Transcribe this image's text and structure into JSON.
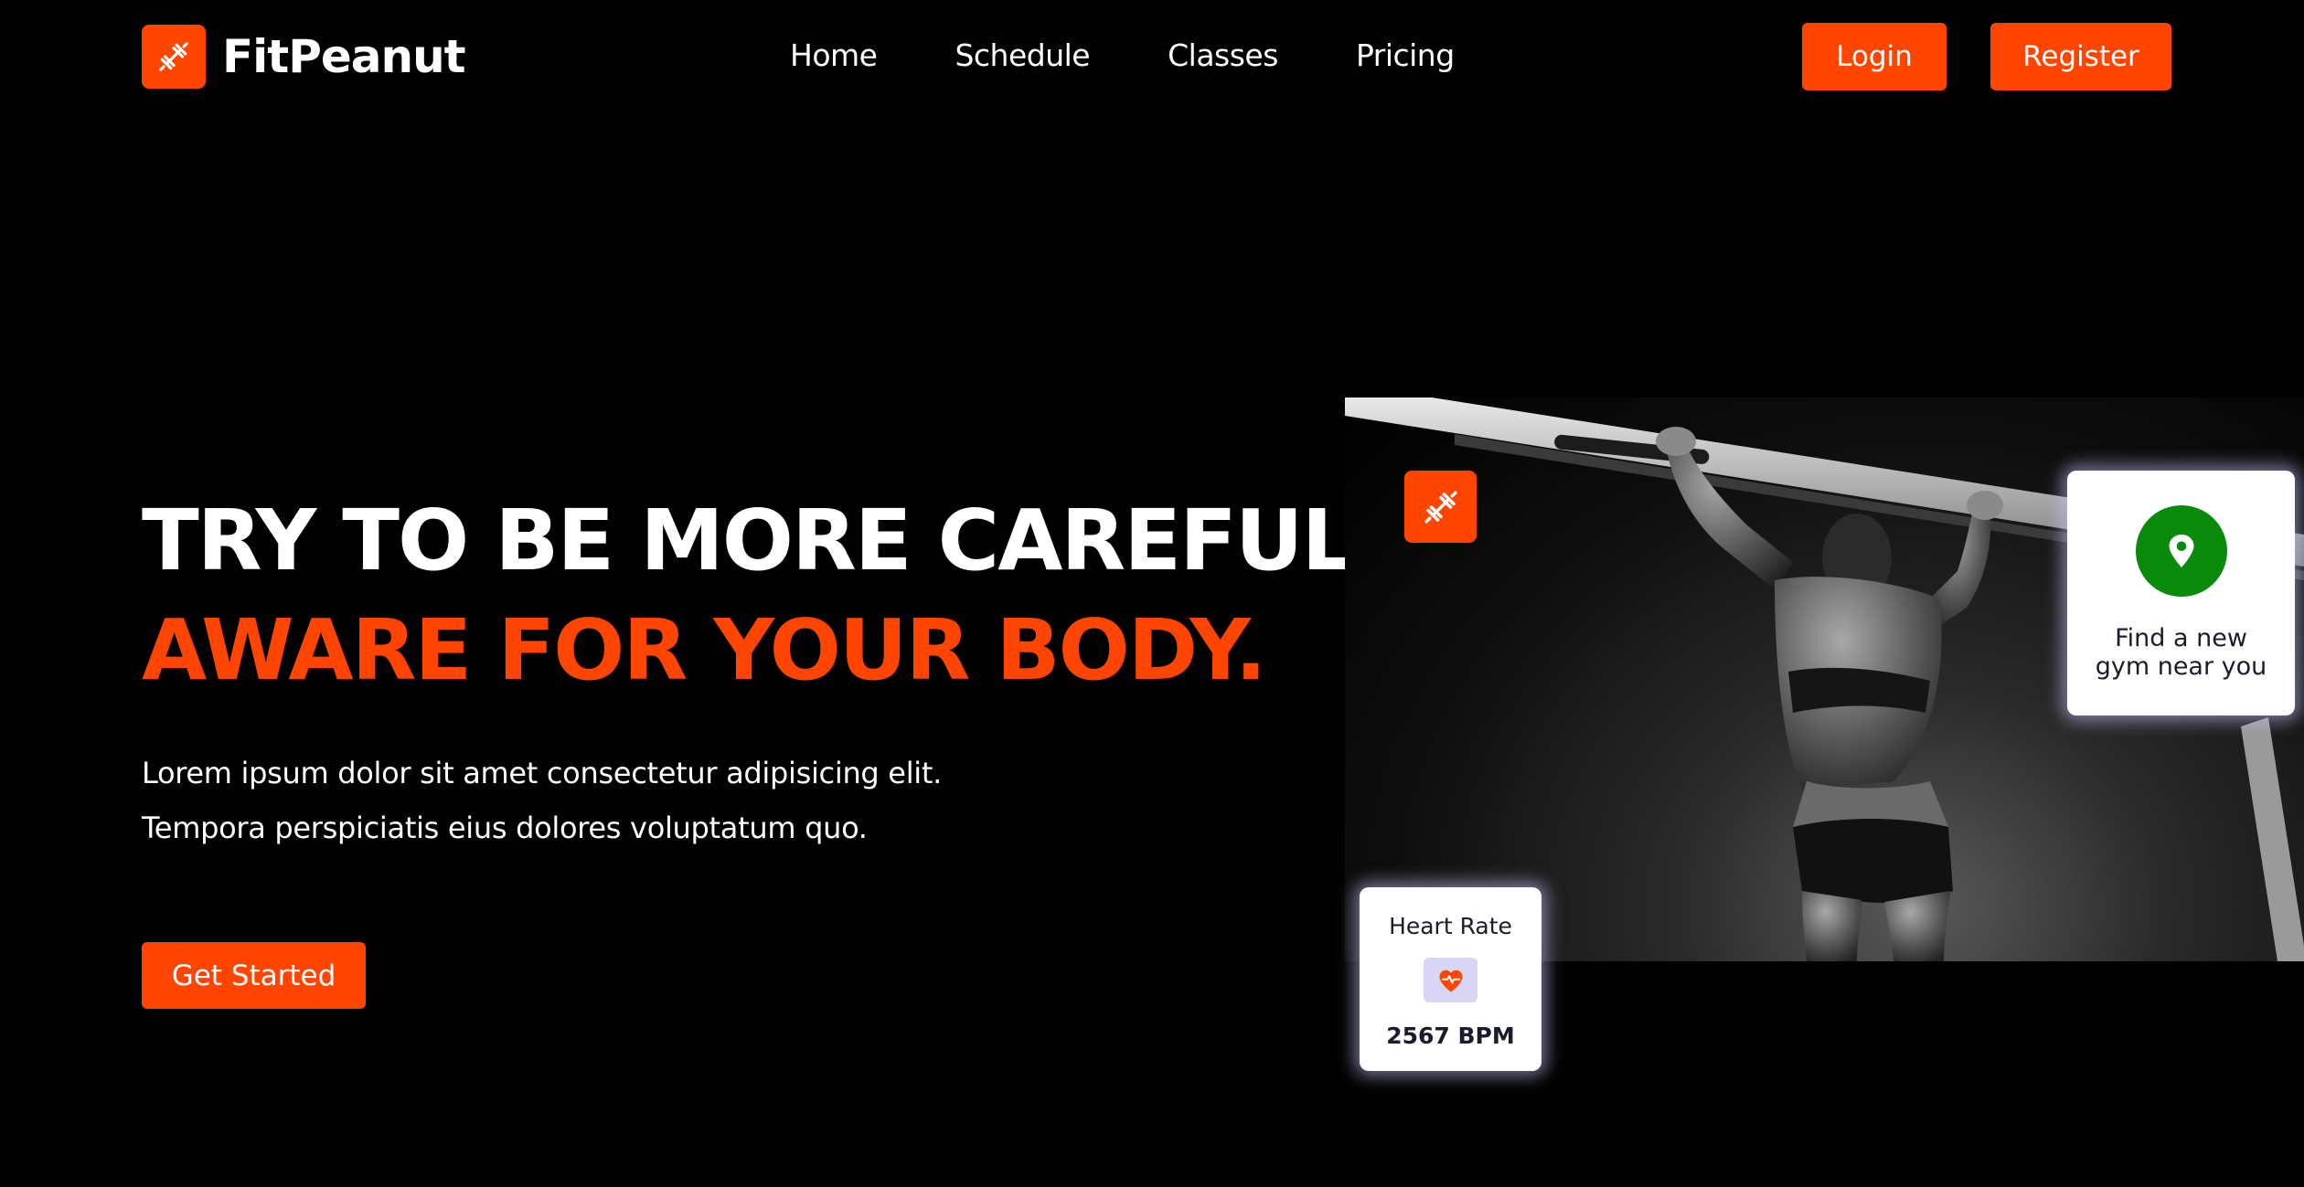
{
  "brand": {
    "name": "FitPeanut",
    "logo_icon": "dumbbell-icon",
    "accent_color": "#ff4500"
  },
  "nav": {
    "items": [
      {
        "label": "Home"
      },
      {
        "label": "Schedule"
      },
      {
        "label": "Classes"
      },
      {
        "label": "Pricing"
      }
    ]
  },
  "auth": {
    "login_label": "Login",
    "register_label": "Register"
  },
  "hero": {
    "title_line1": "TRY TO BE MORE CAREFUL",
    "title_line2": "AWARE FOR YOUR BODY.",
    "description_line1": "Lorem ipsum dolor sit amet consectetur adipisicing elit.",
    "description_line2": "Tempora perspiciatis eius dolores voluptatum quo.",
    "cta_label": "Get Started"
  },
  "gym_card": {
    "icon": "location-pin-icon",
    "icon_color": "#0a8a0a",
    "text_line1": "Find a new",
    "text_line2": "gym near you"
  },
  "heart_card": {
    "label": "Heart Rate",
    "icon": "heart-pulse-icon",
    "value": "2567 BPM"
  },
  "photo": {
    "subject": "woman-doing-pull-ups",
    "style": "black-and-white"
  }
}
